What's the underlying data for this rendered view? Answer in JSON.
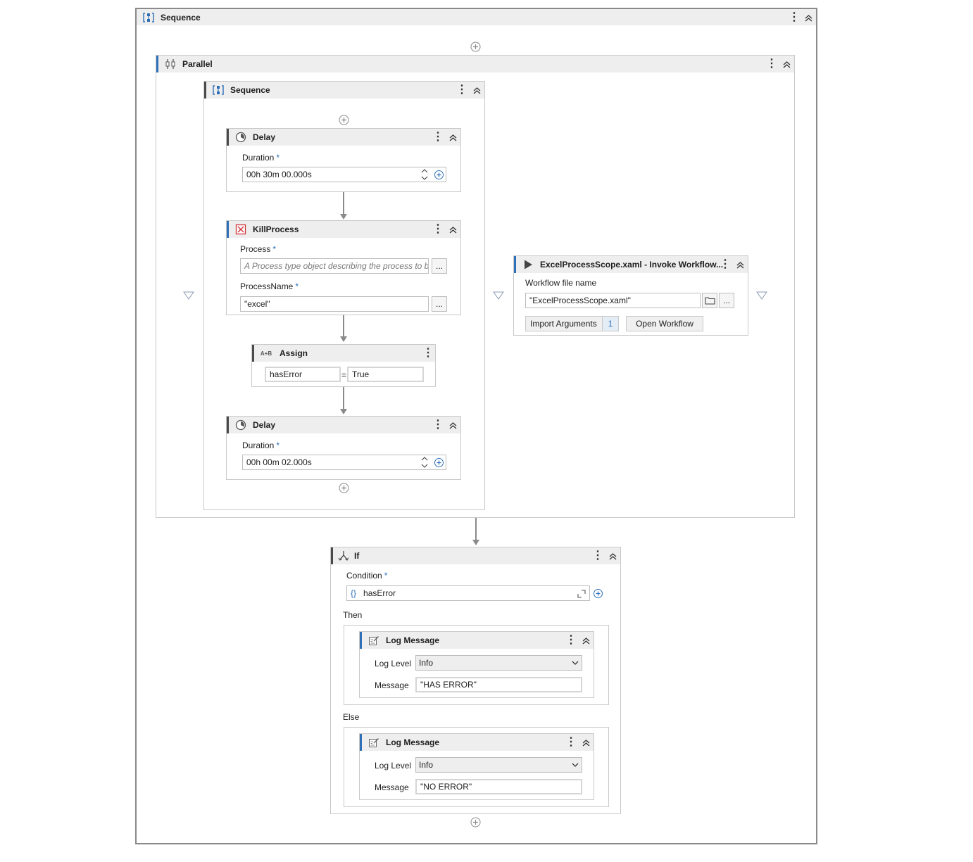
{
  "outer_sequence": {
    "title": "Sequence"
  },
  "parallel": {
    "title": "Parallel"
  },
  "inner_sequence": {
    "title": "Sequence"
  },
  "delay1": {
    "title": "Delay",
    "duration_label": "Duration",
    "required_mark": "*",
    "duration_value": "00h 30m 00.000s"
  },
  "kill_process": {
    "title": "KillProcess",
    "process_label": "Process",
    "process_placeholder": "A Process type object describing the process to be",
    "process_name_label": "ProcessName",
    "process_name_value": "\"excel\"",
    "required_mark": "*",
    "more_label": "..."
  },
  "assign": {
    "title": "Assign",
    "icon_text": "A+B",
    "to_value": "hasError",
    "equals": "=",
    "value": "True"
  },
  "delay2": {
    "title": "Delay",
    "duration_label": "Duration",
    "required_mark": "*",
    "duration_value": "00h 00m 02.000s"
  },
  "invoke": {
    "title": "ExcelProcessScope.xaml - Invoke Workflow...",
    "file_label": "Workflow file name",
    "file_value": "\"ExcelProcessScope.xaml\"",
    "more_label": "...",
    "import_label": "Import Arguments",
    "import_count": "1",
    "open_label": "Open Workflow"
  },
  "if_activity": {
    "title": "If",
    "condition_label": "Condition",
    "required_mark": "*",
    "condition_brace": "{}",
    "condition_value": "hasError",
    "then_label": "Then",
    "else_label": "Else"
  },
  "log_then": {
    "title": "Log Message",
    "level_label": "Log Level",
    "level_value": "Info",
    "message_label": "Message",
    "message_value": "\"HAS ERROR\""
  },
  "log_else": {
    "title": "Log Message",
    "level_label": "Log Level",
    "level_value": "Info",
    "message_label": "Message",
    "message_value": "\"NO ERROR\""
  },
  "colors": {
    "accent": "#2f6fb8",
    "header_bg": "#eeeeee",
    "border": "#c9c9c9",
    "connector": "#8a8a8a",
    "kill_icon": "#d13438"
  }
}
